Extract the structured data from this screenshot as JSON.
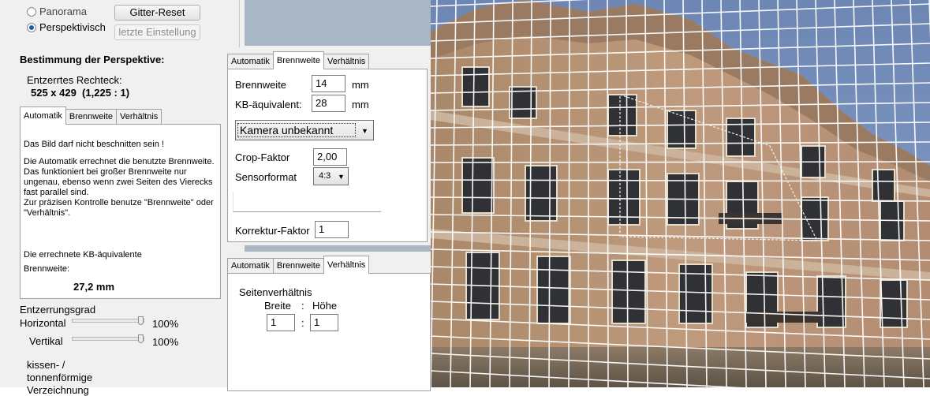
{
  "mode": {
    "option_panorama": "Panorama",
    "option_perspective": "Perspektivisch",
    "btn_grid_reset": "Gitter-Reset",
    "btn_last_setting": "letzte Einstellung"
  },
  "perspective": {
    "heading": "Bestimmung der Perspektive:",
    "rect_label": "Entzerrtes Rechteck:",
    "rect_value": "525 x 429  (1,225 : 1)"
  },
  "tabs": {
    "auto": "Automatik",
    "focal": "Brennweite",
    "ratio": "Verhältnis"
  },
  "auto_tab": {
    "line1": "Das Bild darf nicht beschnitten sein !",
    "para1": "Die Automatik errechnet die benutzte Brennweite. Das funktioniert bei großer Brennweite nur ungenau, ebenso wenn zwei Seiten des Vierecks fast parallel sind.",
    "para2": "Zur präzisen Kontrolle benutze \"Brennweite\" oder \"Verhältnis\".",
    "result_label1": "Die errechnete KB-äquivalente",
    "result_label2": "Brennweite:",
    "result_value": "27,2 mm"
  },
  "correction": {
    "heading": "Entzerrungsgrad",
    "horizontal_label": "Horizontal",
    "horizontal_value": "100%",
    "vertical_label": "Vertikal",
    "vertical_value": "100%",
    "distortion_label1": "kissen- /",
    "distortion_label2": "tonnenförmige",
    "distortion_label3": "Verzeichnung"
  },
  "focal_tab": {
    "focal_label": "Brennweite",
    "focal_value": "14",
    "unit": "mm",
    "kb_label": "KB-äquivalent:",
    "kb_value": "28",
    "camera_select": "Kamera unbekannt",
    "crop_label": "Crop-Faktor",
    "crop_value": "2,00",
    "sensor_label": "Sensorformat",
    "sensor_value": "4:3",
    "correction_label": "Korrektur-Faktor",
    "correction_value": "1"
  },
  "ratio_tab": {
    "heading": "Seitenverhältnis",
    "width_label": "Breite",
    "separator": ":",
    "height_label": "Höhe",
    "width_value": "1",
    "height_value": "1"
  },
  "colors": {
    "accent": "#1d5db0",
    "panel": "#f0f0f0",
    "border": "#a0a0a0"
  }
}
